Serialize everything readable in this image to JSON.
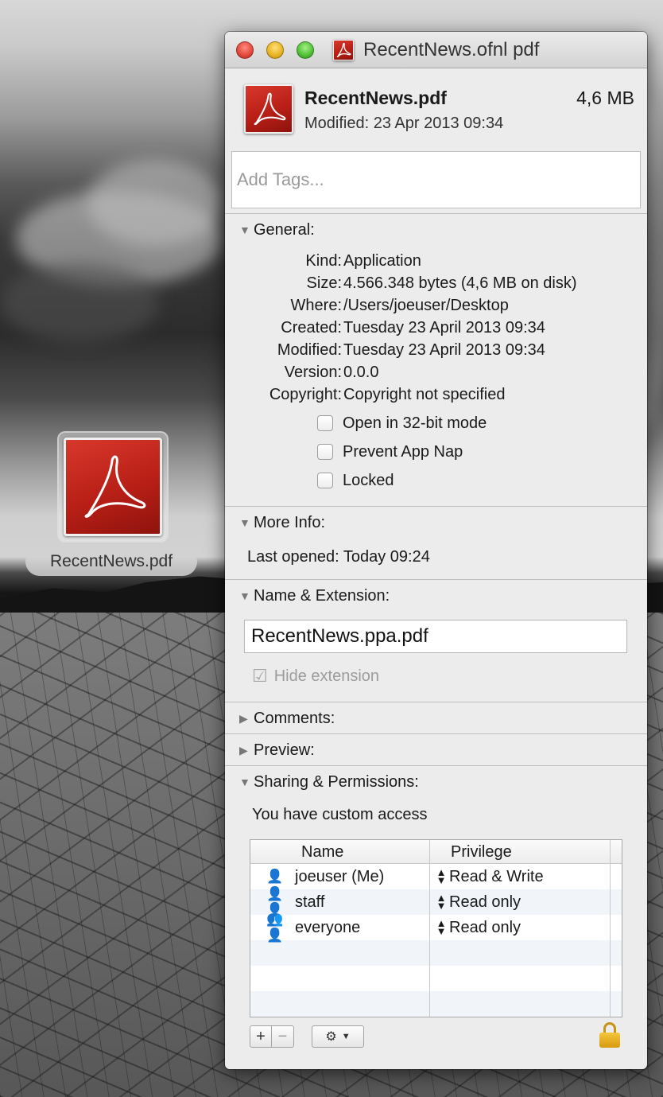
{
  "desktop": {
    "icon_label": "RecentNews.pdf"
  },
  "window": {
    "title": "RecentNews.ofnl pdf"
  },
  "header": {
    "filename": "RecentNews.pdf",
    "size": "4,6 MB",
    "modified": "Modified: 23 Apr 2013 09:34",
    "tags_placeholder": "Add Tags..."
  },
  "general": {
    "heading": "General:",
    "rows": [
      {
        "key": "Kind:",
        "value": "Application"
      },
      {
        "key": "Size:",
        "value": "4.566.348 bytes (4,6 MB on disk)"
      },
      {
        "key": "Where:",
        "value": "/Users/joeuser/Desktop"
      },
      {
        "key": "Created:",
        "value": "Tuesday 23 April 2013 09:34"
      },
      {
        "key": "Modified:",
        "value": "Tuesday 23 April 2013 09:34"
      },
      {
        "key": "Version:",
        "value": "0.0.0"
      },
      {
        "key": "Copyright:",
        "value": "Copyright not specified"
      }
    ],
    "checkboxes": [
      {
        "label": "Open in 32-bit mode",
        "checked": false
      },
      {
        "label": "Prevent App Nap",
        "checked": false
      },
      {
        "label": "Locked",
        "checked": false
      }
    ]
  },
  "more_info": {
    "heading": "More Info:",
    "last_opened": "Last opened: Today 09:24"
  },
  "name_ext": {
    "heading": "Name & Extension:",
    "value": "RecentNews.ppa.pdf",
    "hide_extension_label": "Hide extension",
    "hide_extension_checked": true
  },
  "comments": {
    "heading": "Comments:"
  },
  "preview": {
    "heading": "Preview:"
  },
  "sharing": {
    "heading": "Sharing & Permissions:",
    "access_text": "You have custom access",
    "columns": {
      "name": "Name",
      "privilege": "Privilege"
    },
    "rows": [
      {
        "name": "joeuser (Me)",
        "privilege": "Read & Write",
        "icon": "single-user-icon"
      },
      {
        "name": "staff",
        "privilege": "Read only",
        "icon": "group-icon"
      },
      {
        "name": "everyone",
        "privilege": "Read only",
        "icon": "everyone-icon"
      }
    ]
  },
  "colors": {
    "pdf_red": "#c0281e",
    "window_bg": "#ececec"
  }
}
